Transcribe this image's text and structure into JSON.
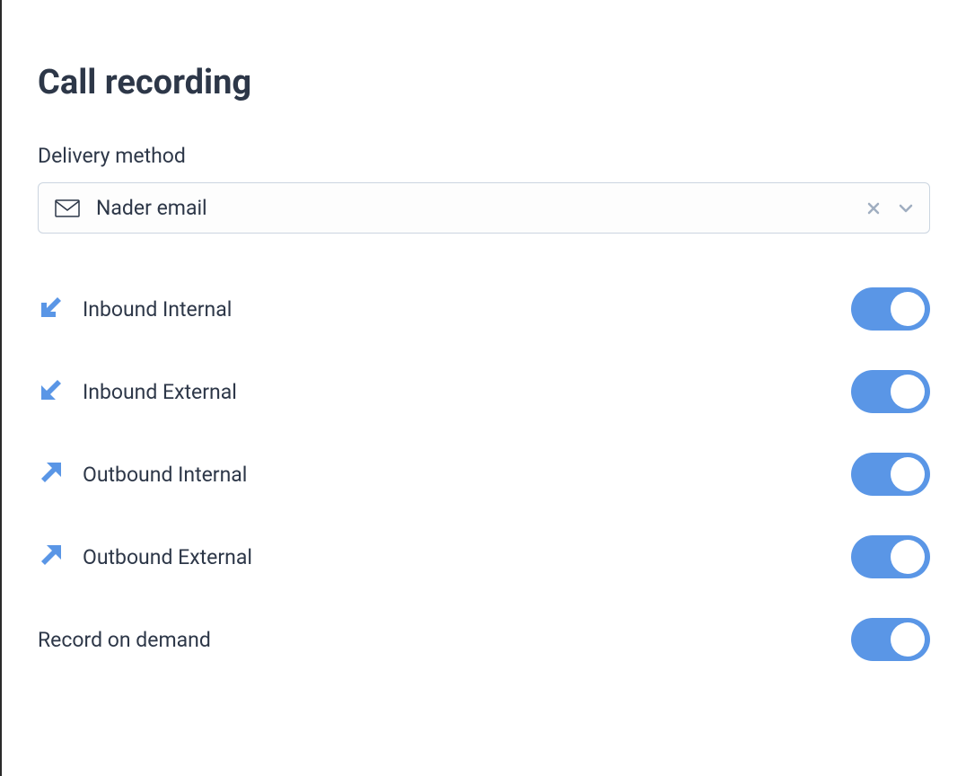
{
  "title": "Call recording",
  "delivery": {
    "label": "Delivery method",
    "value": "Nader email"
  },
  "toggles": {
    "inbound_internal": {
      "label": "Inbound Internal",
      "on": true
    },
    "inbound_external": {
      "label": "Inbound External",
      "on": true
    },
    "outbound_internal": {
      "label": "Outbound Internal",
      "on": true
    },
    "outbound_external": {
      "label": "Outbound External",
      "on": true
    },
    "record_on_demand": {
      "label": "Record on demand",
      "on": true
    }
  },
  "colors": {
    "accent": "#5a96e6",
    "text": "#2d3748",
    "border": "#cbd5e0",
    "icon_muted": "#a0aec0"
  }
}
